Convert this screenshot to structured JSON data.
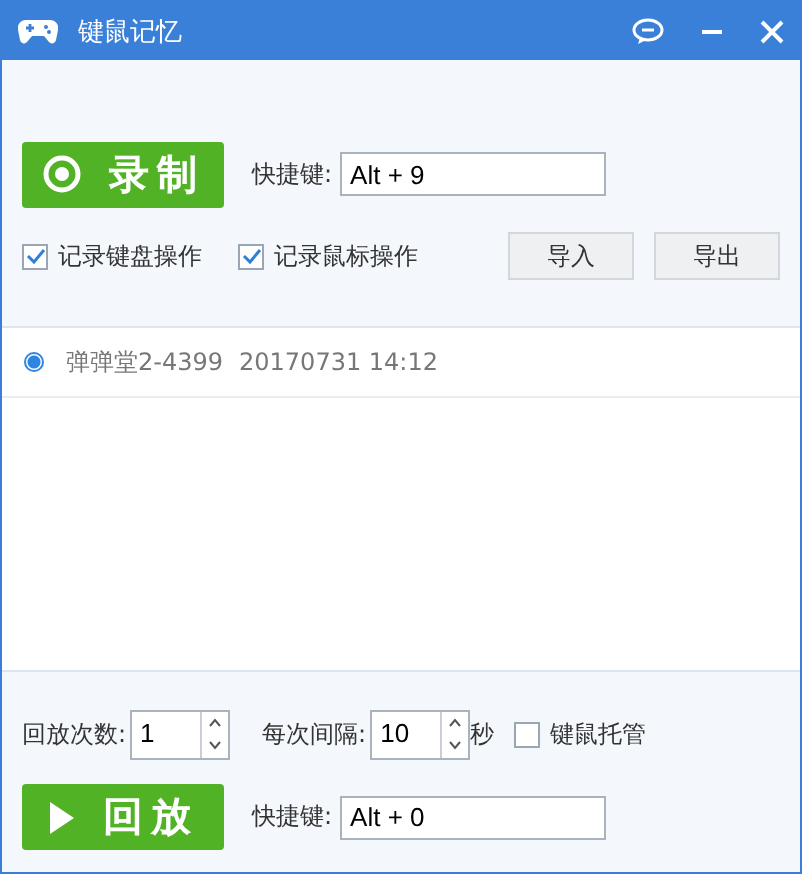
{
  "window": {
    "title": "键鼠记忆"
  },
  "record": {
    "button": "录制",
    "hotkey_label": "快捷键:",
    "hotkey": "Alt + 9"
  },
  "options": [
    {
      "label": "记录键盘操作",
      "checked": true
    },
    {
      "label": "记录鼠标操作",
      "checked": true
    }
  ],
  "actions": [
    "导入",
    "导出"
  ],
  "recordings": [
    {
      "name": "弹弹堂2-4399",
      "time": "20170731 14:12",
      "selected": true
    }
  ],
  "playback": {
    "count_label": "回放次数:",
    "count": "1",
    "interval_label": "每次间隔:",
    "interval": "10",
    "unit": "秒",
    "managed": {
      "label": "键鼠托管",
      "checked": false
    },
    "button": "回放",
    "hotkey_label": "快捷键:",
    "hotkey": "Alt + 0"
  }
}
